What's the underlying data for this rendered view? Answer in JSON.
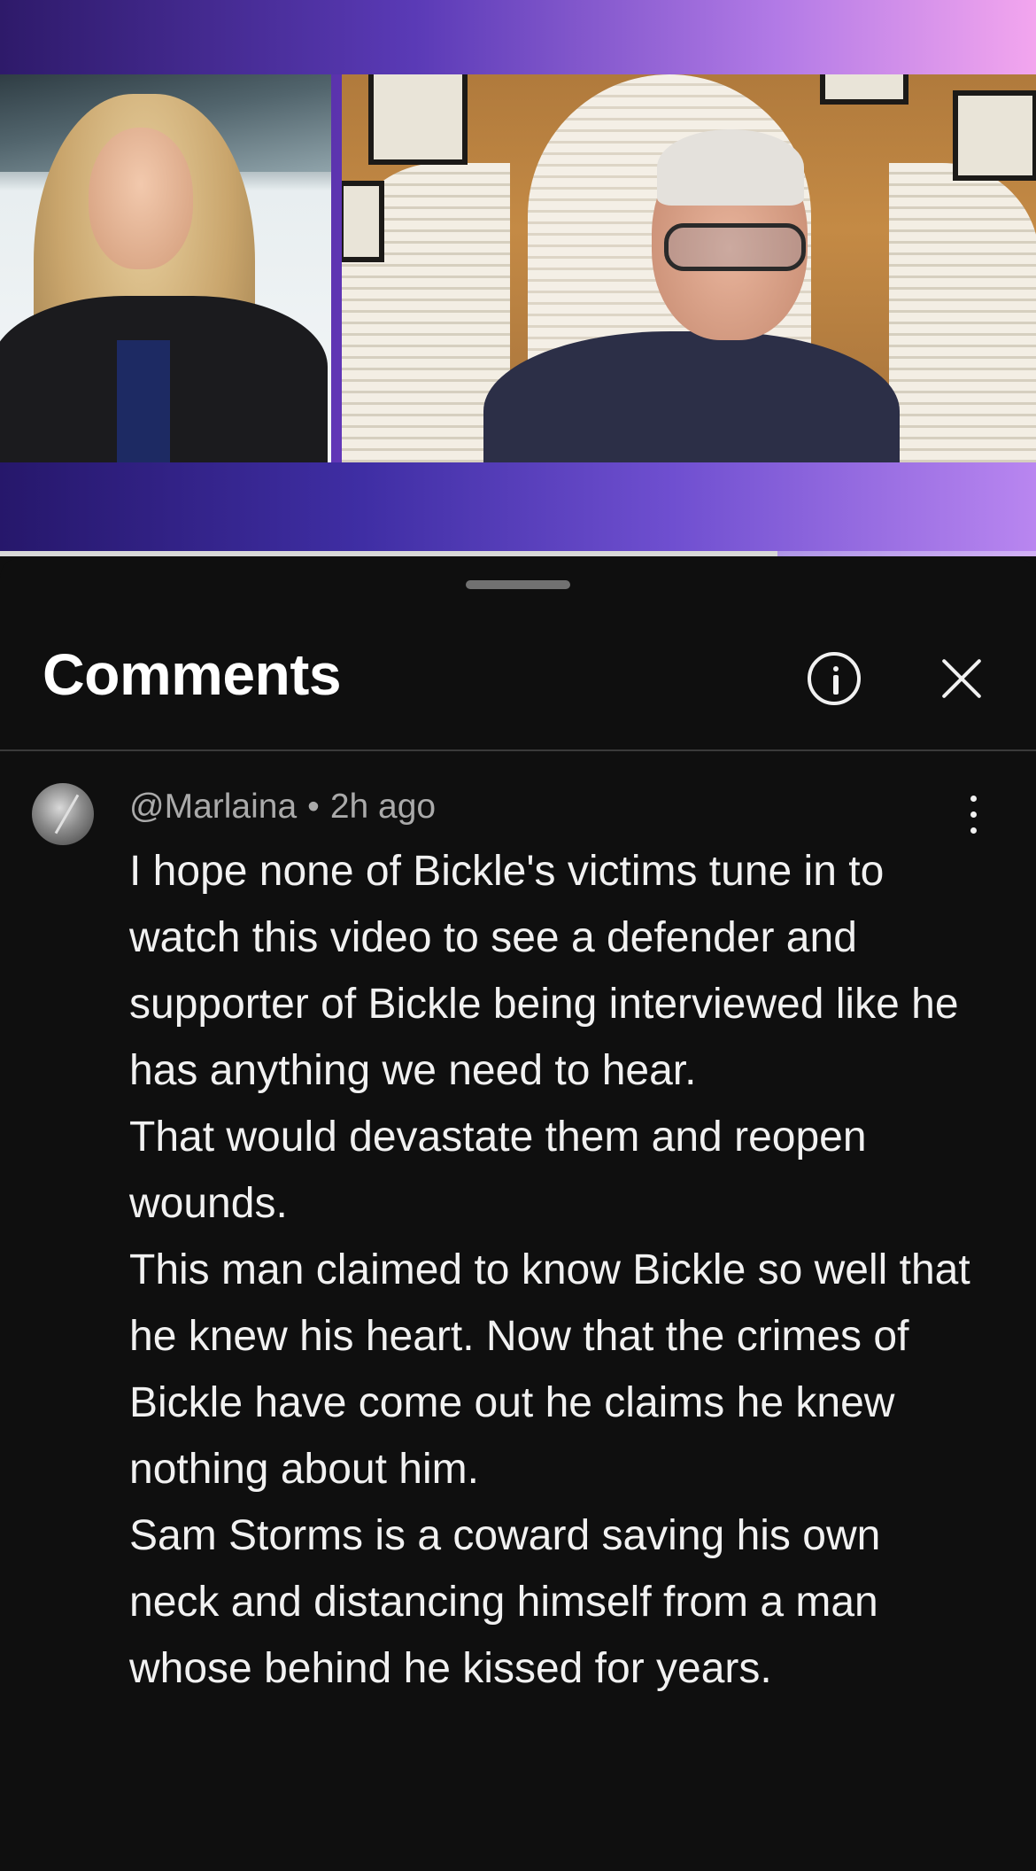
{
  "video": {
    "progress_fraction": 0.75
  },
  "sheet": {
    "title": "Comments",
    "info_icon": "info-icon",
    "close_icon": "close-icon"
  },
  "comment": {
    "author": "@Marlaina",
    "separator": "•",
    "time": "2h ago",
    "more_icon": "more-vert-icon",
    "paragraphs": [
      "I hope none of Bickle's victims tune in to watch this video to see a defender and supporter of Bickle being interviewed like he has anything we need to hear.",
      "That would devastate them and reopen wounds.",
      "This man claimed to know Bickle so well that he knew his heart. Now that the crimes of Bickle have come out he claims he knew nothing about him.",
      "Sam Storms is a coward saving his own neck and distancing himself from a man whose behind he kissed for years."
    ]
  },
  "colors": {
    "background": "#0f0f0f",
    "text_primary": "#f1f1f1",
    "text_secondary": "#aaaaaa",
    "video_gradient_left": "#3a1f7a",
    "video_gradient_right": "#f09af0"
  }
}
